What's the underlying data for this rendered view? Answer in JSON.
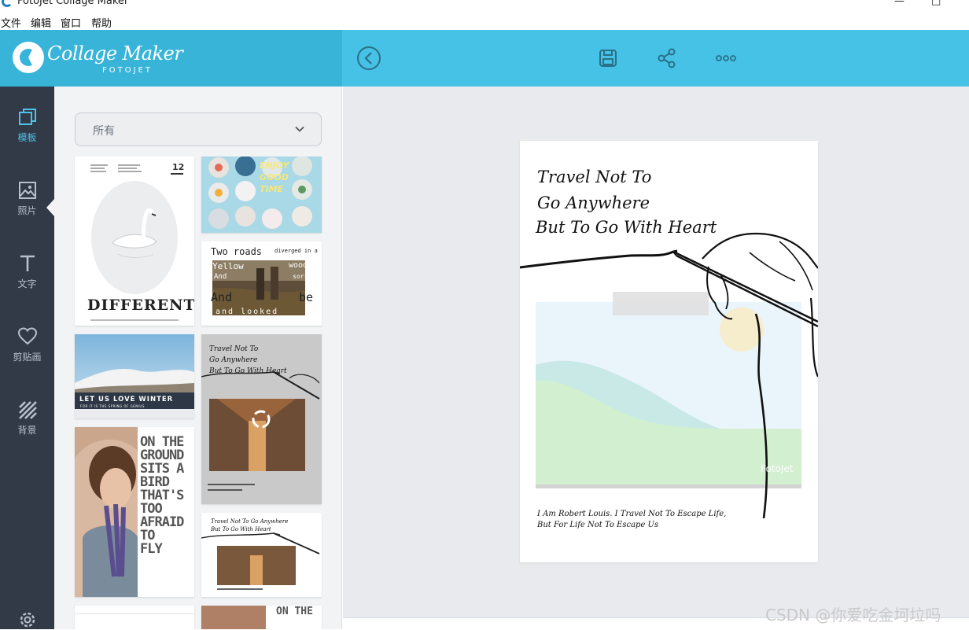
{
  "window": {
    "title": "FotoJet Collage Maker"
  },
  "menu": [
    "文件",
    "编辑",
    "窗口",
    "帮助"
  ],
  "brand": {
    "name": "Collage Maker",
    "sub": "FOTOJET"
  },
  "sidebar": {
    "items": [
      {
        "label": "模板",
        "icon": "template-icon"
      },
      {
        "label": "照片",
        "icon": "photo-icon"
      },
      {
        "label": "文字",
        "icon": "text-icon"
      },
      {
        "label": "剪贴画",
        "icon": "heart-icon"
      },
      {
        "label": "背景",
        "icon": "background-icon"
      }
    ],
    "settings_icon": "gear-icon"
  },
  "panel": {
    "filter_value": "所有",
    "templates": {
      "swan": {
        "title": "DIFFERENT",
        "day": "12"
      },
      "enjoy": {
        "lines": [
          "ENJOY",
          "GOOD",
          "TIME"
        ]
      },
      "road": {
        "line1": "Two roads",
        "line1b": "diverged in a",
        "line2": "Yellow",
        "line2b": "wood",
        "line3": "And",
        "line3b": "sorry",
        "line4": "And",
        "line4b": "be",
        "line5": "and looked"
      },
      "winter": {
        "title": "LET US LOVE WINTER",
        "sub": "FOR IT IS THE SPRING OF GENIUS"
      },
      "hand": {
        "line1": "Travel Not To",
        "line2": "Go Anywhere",
        "line3": "But To Go With Heart",
        "caption": "I Am Robert Louis. I Travel Not To Escape Life,",
        "caption2": "But For Life Not To Escape Us"
      },
      "girl": {
        "lines": [
          "ON THE",
          "GROUND",
          "SITS A",
          "BIRD",
          "THAT'S",
          "TOO",
          "AFRAID",
          "TO",
          "FLY"
        ]
      },
      "hand2": {
        "line1": "Travel Not To Go Anywhere",
        "line2": "But To Go With Heart"
      },
      "partial": {
        "text": "ON THE"
      }
    }
  },
  "collage": {
    "line1": "Travel Not To",
    "line2": "Go Anywhere",
    "line3": "But To Go With Heart",
    "caption1": "I Am Robert Louis. I Travel Not To Escape Life,",
    "caption2": "But For Life Not To Escape Us",
    "photo_label": "FotoJet"
  },
  "watermark": "CSDN @你爱吃金坷垃吗",
  "colors": {
    "header": "#38b4d9",
    "header_right": "#45c2e5",
    "sidebar": "#323a47",
    "accent": "#4cc3ea"
  }
}
